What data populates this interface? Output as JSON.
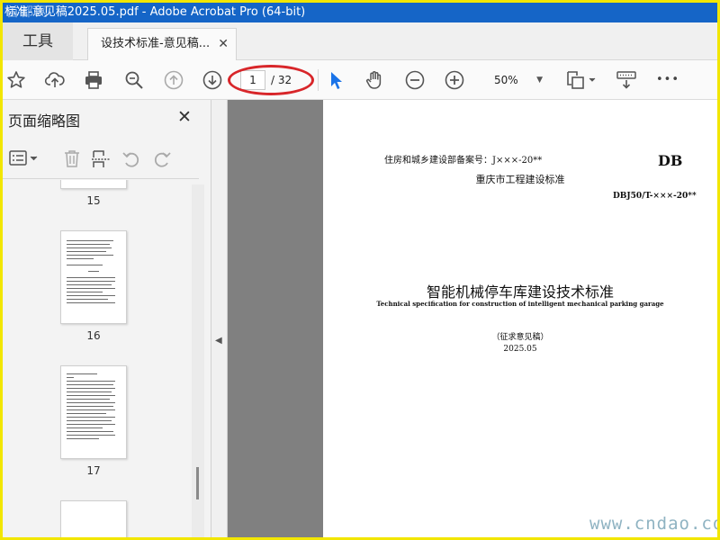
{
  "window": {
    "title": "标准-意见稿2025.05.pdf - Adobe Acrobat Pro (64-bit)",
    "watermark_top": "首都网"
  },
  "tabs": {
    "tools_label": "工具",
    "document_label": "设技术标准-意见稿...",
    "close_glyph": "✕"
  },
  "toolbar": {
    "icons": [
      "star-icon",
      "upload-icon",
      "print-icon",
      "zoom-search-icon",
      "page-up-icon",
      "page-down-icon",
      "select-arrow-icon",
      "hand-icon",
      "zoom-out-icon",
      "zoom-in-icon",
      "fit-page-icon",
      "keyboard-icon",
      "more-icon"
    ],
    "current_page": "1",
    "total_pages": "/ 32",
    "zoom_level": "50%",
    "more_glyph": "•••",
    "highlight_color": "#d8262a"
  },
  "panel": {
    "title": "页面缩略图",
    "close_glyph": "✕",
    "thumbnails": [
      {
        "number": "15"
      },
      {
        "number": "16"
      },
      {
        "number": "17"
      }
    ]
  },
  "document": {
    "record_number": "住房和城乡建设部备案号：J×××-20**",
    "db_label": "DB",
    "standard_type": "重庆市工程建设标准",
    "standard_code": "DBJ50/T-×××-20**",
    "title": "智能机械停车库建设技术标准",
    "subtitle": "Technical specification for construction of intelligent mechanical parking garage",
    "draft_label": "（征求意见稿）",
    "date": "2025.05"
  },
  "watermark_bottom": "www.cndao.com",
  "colors": {
    "titlebar": "#1565c7",
    "frame": "#f2e600",
    "select_arrow": "#1a73e8"
  }
}
